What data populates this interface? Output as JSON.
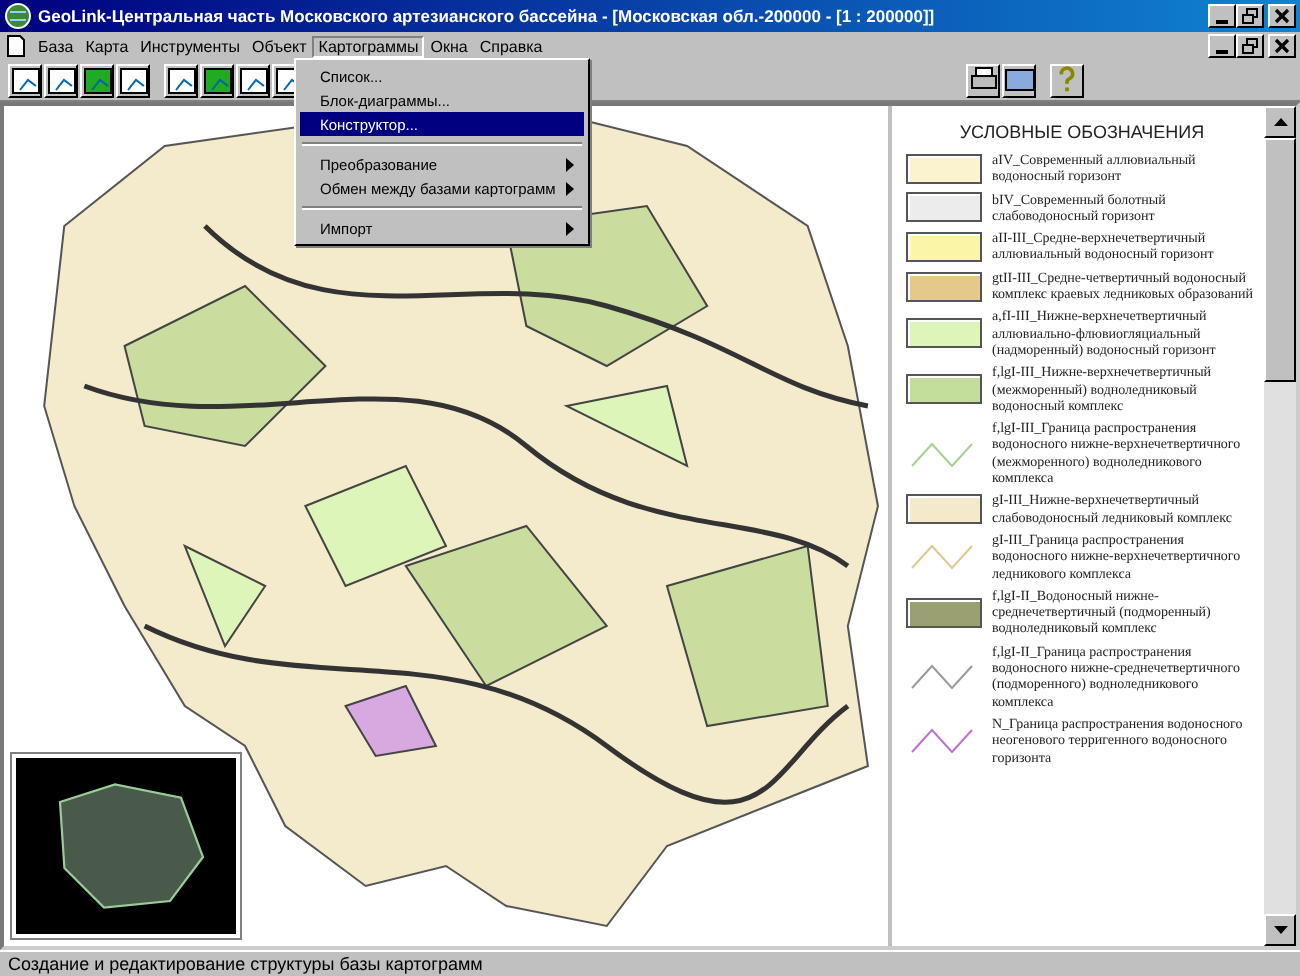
{
  "window": {
    "title": "GeoLink-Центральная часть Московского артезианского бассейна - [Московская обл.-200000 - [1 : 200000]]"
  },
  "menu_bar": [
    {
      "label": "База",
      "selected": false
    },
    {
      "label": "Карта",
      "selected": false
    },
    {
      "label": "Инструменты",
      "selected": false
    },
    {
      "label": "Объект",
      "selected": false
    },
    {
      "label": "Картограммы",
      "selected": true
    },
    {
      "label": "Окна",
      "selected": false
    },
    {
      "label": "Справка",
      "selected": false
    }
  ],
  "dropdown": [
    {
      "kind": "item",
      "label": "Список...",
      "selected": false,
      "submenu": false
    },
    {
      "kind": "item",
      "label": "Блок-диаграммы...",
      "selected": false,
      "submenu": false
    },
    {
      "kind": "item",
      "label": "Конструктор...",
      "selected": true,
      "submenu": false
    },
    {
      "kind": "separator"
    },
    {
      "kind": "item",
      "label": "Преобразование",
      "selected": false,
      "submenu": true
    },
    {
      "kind": "item",
      "label": "Обмен между базами картограмм",
      "selected": false,
      "submenu": true
    },
    {
      "kind": "separator"
    },
    {
      "kind": "item",
      "label": "Импорт",
      "selected": false,
      "submenu": true
    }
  ],
  "legend": {
    "title": "УСЛОВНЫЕ ОБОЗНАЧЕНИЯ",
    "items": [
      {
        "kind": "fill",
        "color": "#fbf3d0",
        "text": "aIV_Современный аллювиальный водоносный горизонт"
      },
      {
        "kind": "fill",
        "color": "#ececec",
        "text": "bIV_Современный болотный слабоводоносный горизонт"
      },
      {
        "kind": "fill",
        "color": "#fbf5a8",
        "text": "aII-III_Средне-верхнечетвертичный аллювиальный водоносный горизонт"
      },
      {
        "kind": "fill",
        "color": "#e5c98a",
        "text": "gtII-III_Средне-четвертичный водоносный комплекс краевых ледниковых образований"
      },
      {
        "kind": "fill",
        "color": "#ddf5b8",
        "text": "a,fI-III_Нижне-верхнечетвертичный аллювиально-флювиогляциальный (надморенный) водоносный горизонт"
      },
      {
        "kind": "fill",
        "color": "#c3dd9a",
        "text": "f,lgI-III_Нижне-верхнечетвертичный (межморенный) водноледниковый водоносный комплекс"
      },
      {
        "kind": "line",
        "color": "#a8d08d",
        "text": "f,lgI-III_Граница распространения водоносного нижне-верхнечетвертичного (межморенного) водноледникового комплекса"
      },
      {
        "kind": "fill",
        "color": "#f5e9cc",
        "text": "gI-III_Нижне-верхнечетвертичный слабоводоносный ледниковый комплекс"
      },
      {
        "kind": "line",
        "color": "#e0c890",
        "text": "gI-III_Граница распространения водоносного нижне-верхнечетвертичного ледникового комплекса"
      },
      {
        "kind": "fill",
        "color": "#9aa070",
        "text": "f,lgI-II_Водоносный нижне-среднечетвертичный (подморенный) водноледниковый комплекс"
      },
      {
        "kind": "line",
        "color": "#9a9a9a",
        "text": "f,lgI-II_Граница распространения водоносного нижне-среднечетвертичного (подморенного) водноледникового комплекса"
      },
      {
        "kind": "line",
        "color": "#c070d0",
        "text": "N_Граница распространения водоносного неогенового терригенного водоносного горизонта"
      }
    ]
  },
  "status_bar": {
    "text": "Создание и редактирование структуры базы картограмм"
  }
}
